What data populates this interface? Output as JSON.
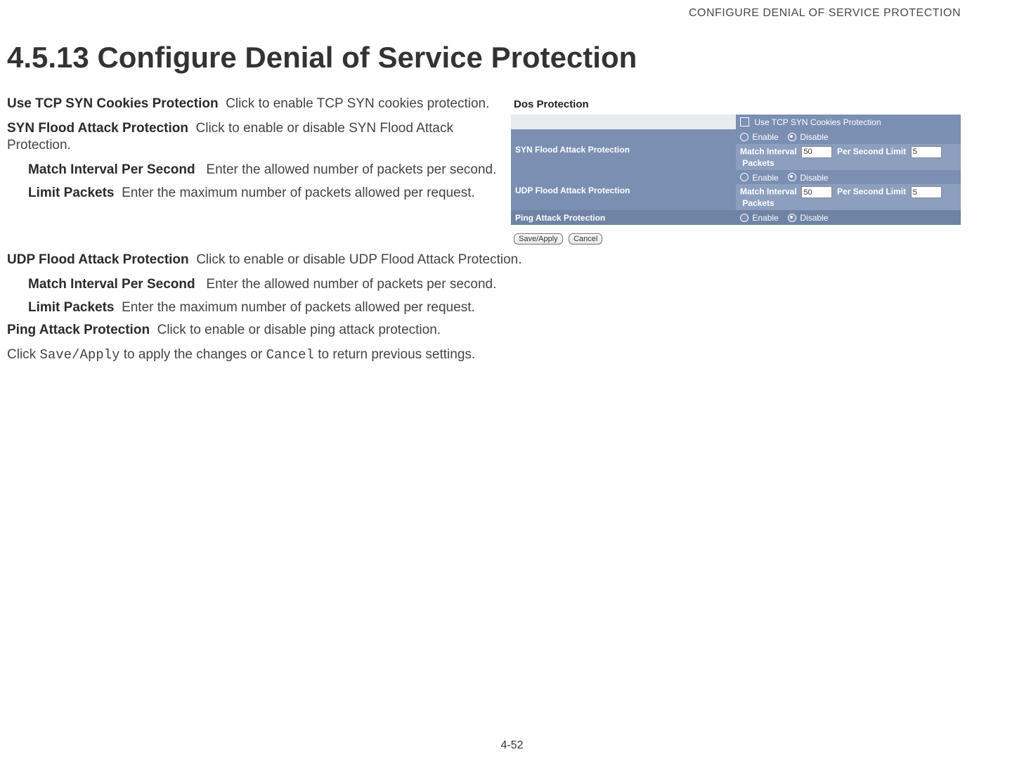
{
  "header": {
    "running_title": "CONFIGURE DENIAL OF SERVICE PROTECTION"
  },
  "section": {
    "title": "4.5.13 Configure Denial of Service Protection"
  },
  "defs": {
    "tcp_syn_cookies": {
      "term": "Use TCP SYN Cookies Protection",
      "desc": "Click to enable TCP SYN cookies protection."
    },
    "syn_flood": {
      "term": "SYN Flood Attack Protection",
      "desc": "Click to enable or disable SYN Flood Attack Protection."
    },
    "match_interval": {
      "term": "Match Interval Per Second",
      "desc": "Enter the allowed number of packets per second."
    },
    "limit_packets": {
      "term": "Limit Packets",
      "desc": "Enter the maximum number of packets allowed per request."
    },
    "udp_flood": {
      "term": "UDP Flood Attack Protection",
      "desc": "Click to enable or disable UDP Flood Attack Protection."
    },
    "match_interval2": {
      "term": "Match Interval Per Second",
      "desc": "Enter the allowed number of packets per second."
    },
    "limit_packets2": {
      "term": "Limit Packets",
      "desc": "Enter the maximum number of packets allowed per request."
    },
    "ping": {
      "term": "Ping Attack Protection",
      "desc": "Click to enable or disable ping attack protection."
    }
  },
  "closing": {
    "pre": "Click ",
    "save_apply": "Save/Apply",
    "mid": " to apply the changes or ",
    "cancel": "Cancel",
    "post": " to return previous settings."
  },
  "figure": {
    "title": "Dos Protection",
    "checkbox_row": {
      "label": "Use TCP SYN Cookies Protection",
      "checked": false
    },
    "rows": {
      "syn": {
        "label": "SYN Flood Attack Protection",
        "enable": "Enable",
        "disable": "Disable",
        "selected": "disable",
        "match_label": "Match Interval",
        "match_value": "50",
        "per_second": "Per Second  Limit",
        "limit_value": "5",
        "packets": "Packets"
      },
      "udp": {
        "label": "UDP Flood Attack Protection",
        "enable": "Enable",
        "disable": "Disable",
        "selected": "disable",
        "match_label": "Match Interval",
        "match_value": "50",
        "per_second": "Per Second  Limit",
        "limit_value": "5",
        "packets": "Packets"
      },
      "ping": {
        "label": "Ping Attack Protection",
        "enable": "Enable",
        "disable": "Disable",
        "selected": "disable"
      }
    },
    "buttons": {
      "save_apply": "Save/Apply",
      "cancel": "Cancel"
    }
  },
  "page_number": "4-52"
}
